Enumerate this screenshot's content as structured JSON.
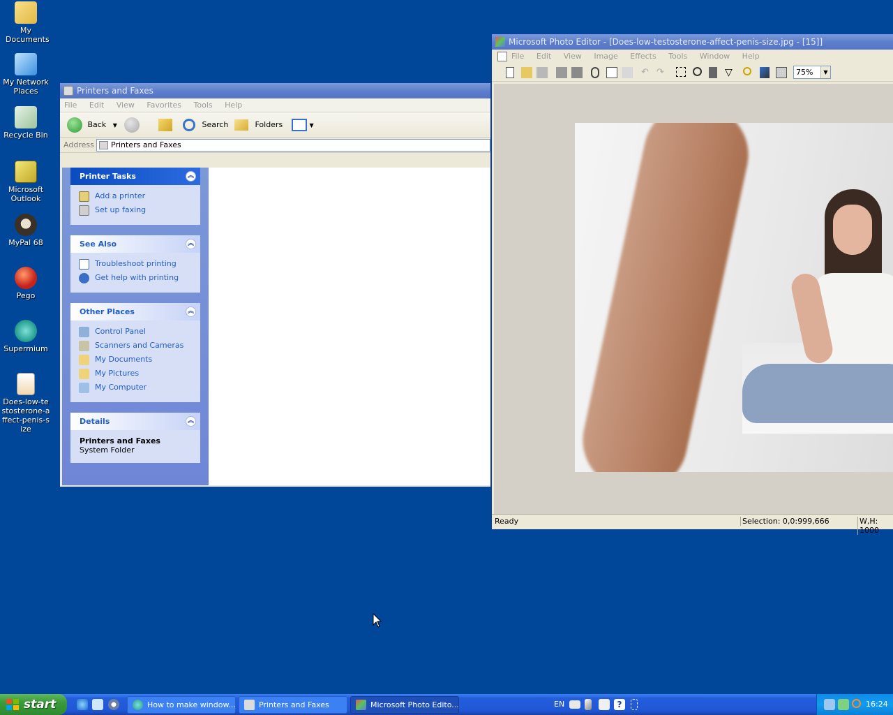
{
  "desktop": {
    "icons": [
      {
        "label": "My Documents"
      },
      {
        "label": "My Network Places"
      },
      {
        "label": "Recycle Bin"
      },
      {
        "label": "Microsoft Outlook"
      },
      {
        "label": "MyPal 68"
      },
      {
        "label": "Pego"
      },
      {
        "label": "Supermium"
      },
      {
        "label": "Does-low-testosterone-affect-penis-size"
      }
    ]
  },
  "printers_window": {
    "title": "Printers and Faxes",
    "menu": [
      "File",
      "Edit",
      "View",
      "Favorites",
      "Tools",
      "Help"
    ],
    "toolbar": {
      "back": "Back",
      "search": "Search",
      "folders": "Folders"
    },
    "address": {
      "label": "Address",
      "value": "Printers and Faxes"
    },
    "panels": {
      "printer_tasks": {
        "title": "Printer Tasks",
        "items": [
          "Add a printer",
          "Set up faxing"
        ]
      },
      "see_also": {
        "title": "See Also",
        "items": [
          "Troubleshoot printing",
          "Get help with printing"
        ]
      },
      "other_places": {
        "title": "Other Places",
        "items": [
          "Control Panel",
          "Scanners and Cameras",
          "My Documents",
          "My Pictures",
          "My Computer"
        ]
      },
      "details": {
        "title": "Details",
        "name": "Printers and Faxes",
        "type": "System Folder"
      }
    }
  },
  "photo_editor": {
    "title": "Microsoft Photo Editor - [Does-low-testosterone-affect-penis-size.jpg - [15]]",
    "menu": [
      "File",
      "Edit",
      "View",
      "Image",
      "Effects",
      "Tools",
      "Window",
      "Help"
    ],
    "zoom": "75%",
    "status": {
      "ready": "Ready",
      "selection": "Selection: 0,0:999,666",
      "wh": "W,H: 1000"
    }
  },
  "taskbar": {
    "start": "start",
    "tasks": [
      "How to make window...",
      "Printers and Faxes",
      "Microsoft Photo Edito..."
    ],
    "language": "EN",
    "clock": "16:24"
  },
  "colors": {
    "desktop": "#00479a",
    "taskbar": "#245edb",
    "start": "#3a9a3a",
    "link": "#215dc6"
  }
}
